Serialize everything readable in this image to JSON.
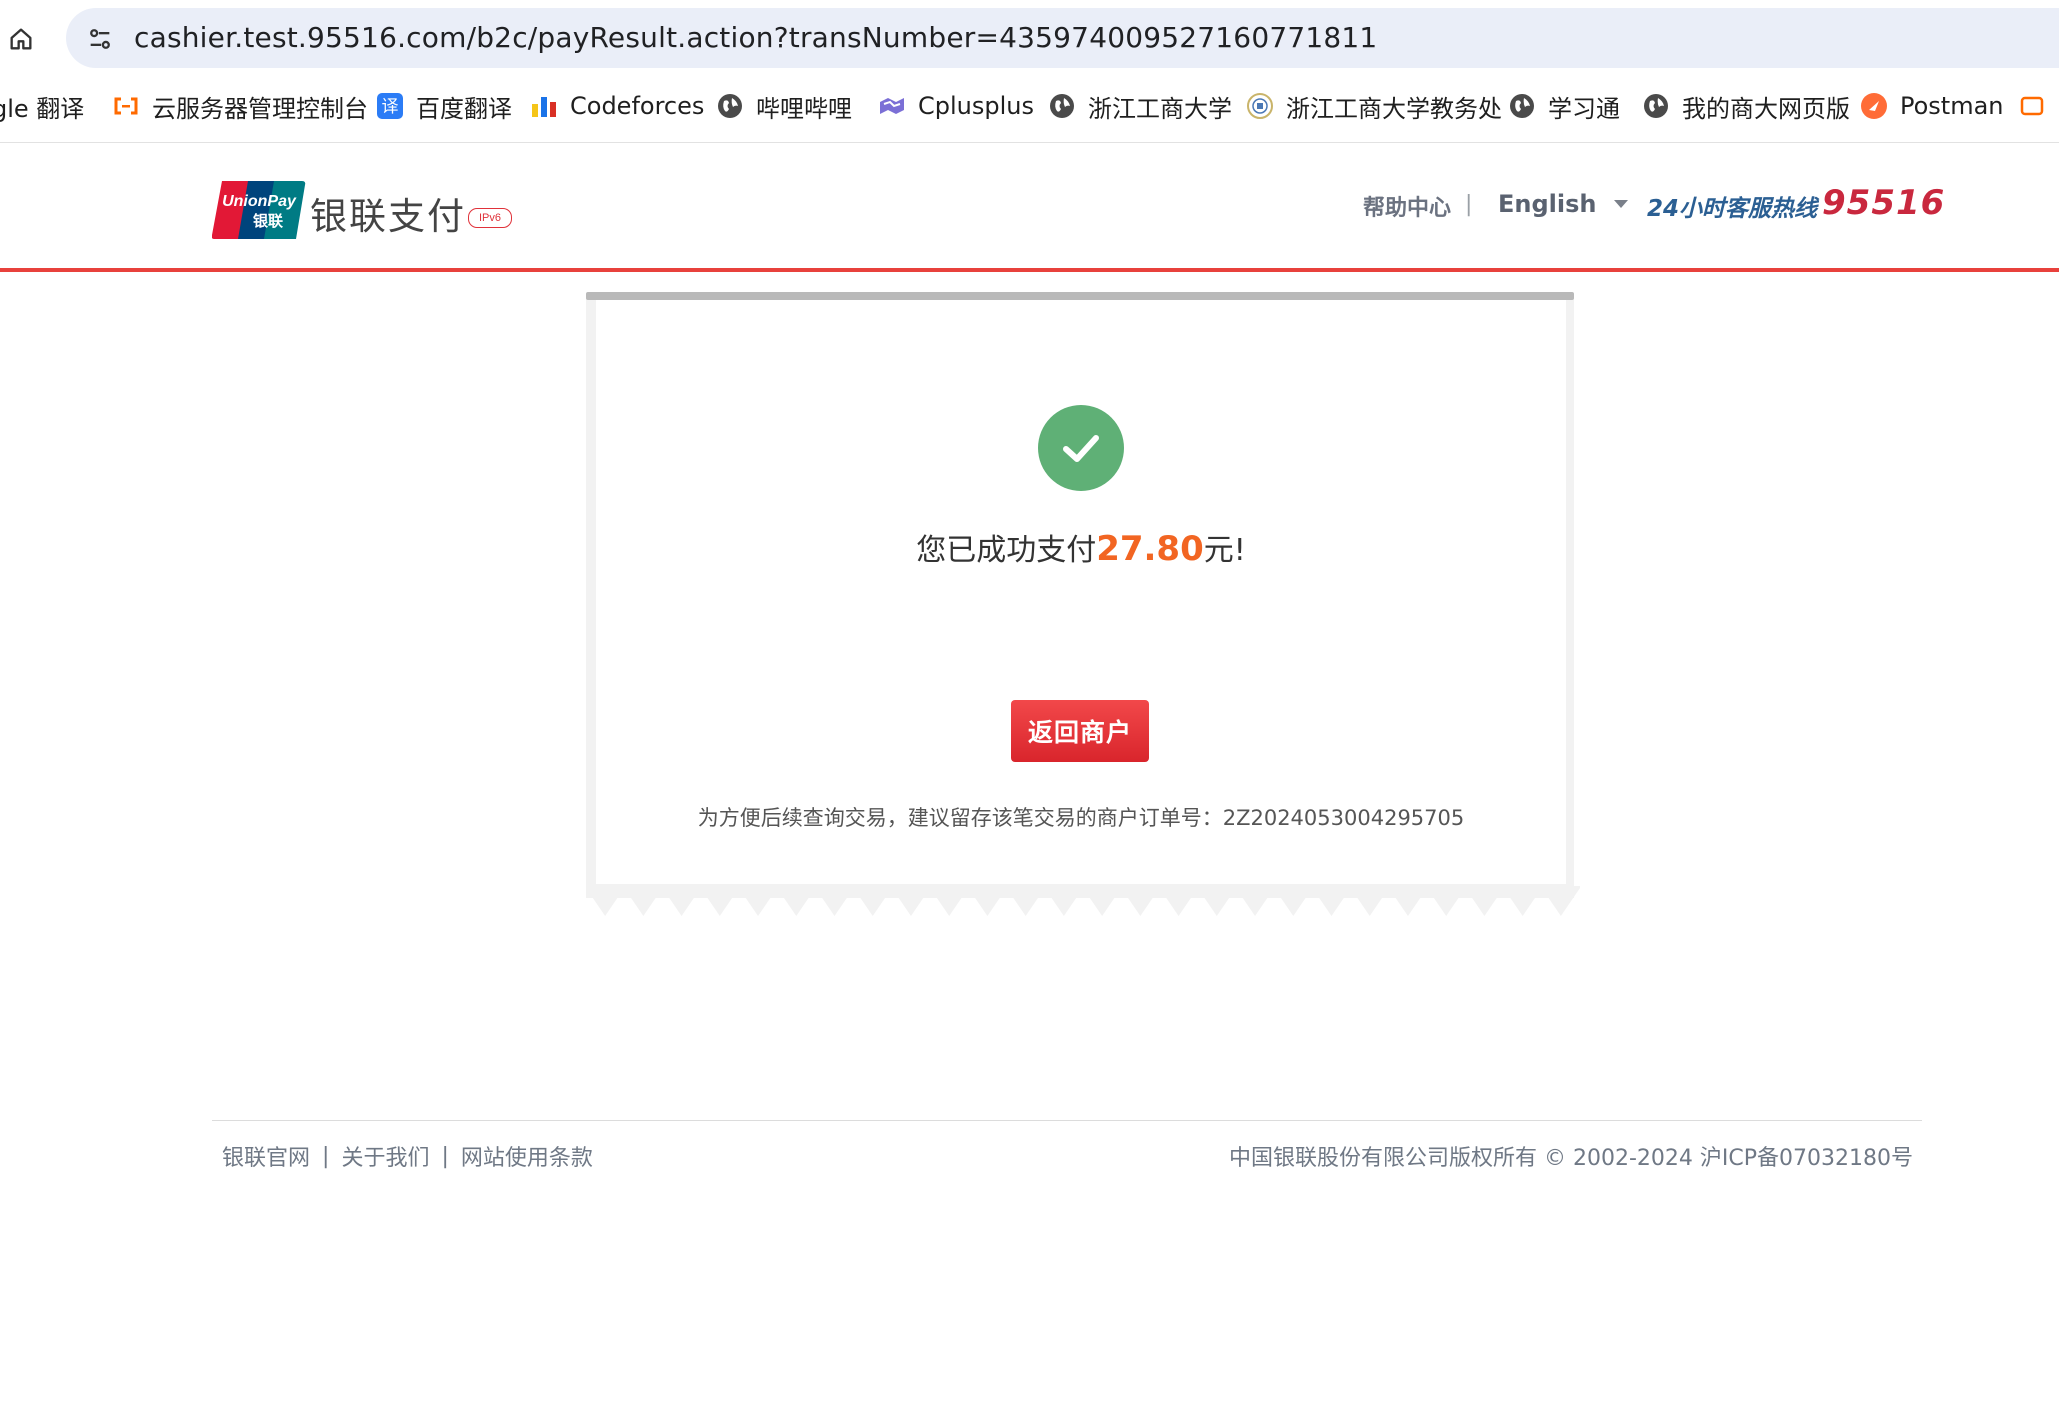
{
  "browser": {
    "url": "cashier.test.95516.com/b2c/payResult.action?transNumber=435974009527160771811",
    "bookmarks": [
      {
        "label": "gle 翻译",
        "icon": "google-translate-icon"
      },
      {
        "label": "云服务器管理控制台",
        "icon": "aliyun-icon"
      },
      {
        "label": "百度翻译",
        "icon": "baidu-translate-icon"
      },
      {
        "label": "Codeforces",
        "icon": "codeforces-icon"
      },
      {
        "label": "哔哩哔哩",
        "icon": "globe-icon"
      },
      {
        "label": "Cplusplus",
        "icon": "cplusplus-icon"
      },
      {
        "label": "浙江工商大学",
        "icon": "globe-icon"
      },
      {
        "label": "浙江工商大学教务处",
        "icon": "university-seal-icon"
      },
      {
        "label": "学习通",
        "icon": "globe-icon"
      },
      {
        "label": "我的商大网页版",
        "icon": "globe-icon"
      },
      {
        "label": "Postman",
        "icon": "postman-icon"
      }
    ]
  },
  "header": {
    "logo_text": "UnionPay 银联",
    "brand": "银联支付",
    "ipv6": "IPv6",
    "help": "帮助中心",
    "separator": "|",
    "language": "English",
    "hotline_label": "24小时客服热线",
    "hotline_number": "95516",
    "accent_color": "#e8413c"
  },
  "result": {
    "prefix": "您已成功支付",
    "amount": "27.80",
    "suffix": "元!",
    "button": "返回商户",
    "order_note": "为方便后续查询交易，建议留存该笔交易的商户订单号：2Z2024053004295705",
    "success_color": "#5fb076",
    "amount_color": "#f26522"
  },
  "footer": {
    "links": [
      "银联官网",
      "关于我们",
      "网站使用条款"
    ],
    "separator": "|",
    "copyright": "中国银联股份有限公司版权所有 © 2002-2024   沪ICP备07032180号"
  }
}
